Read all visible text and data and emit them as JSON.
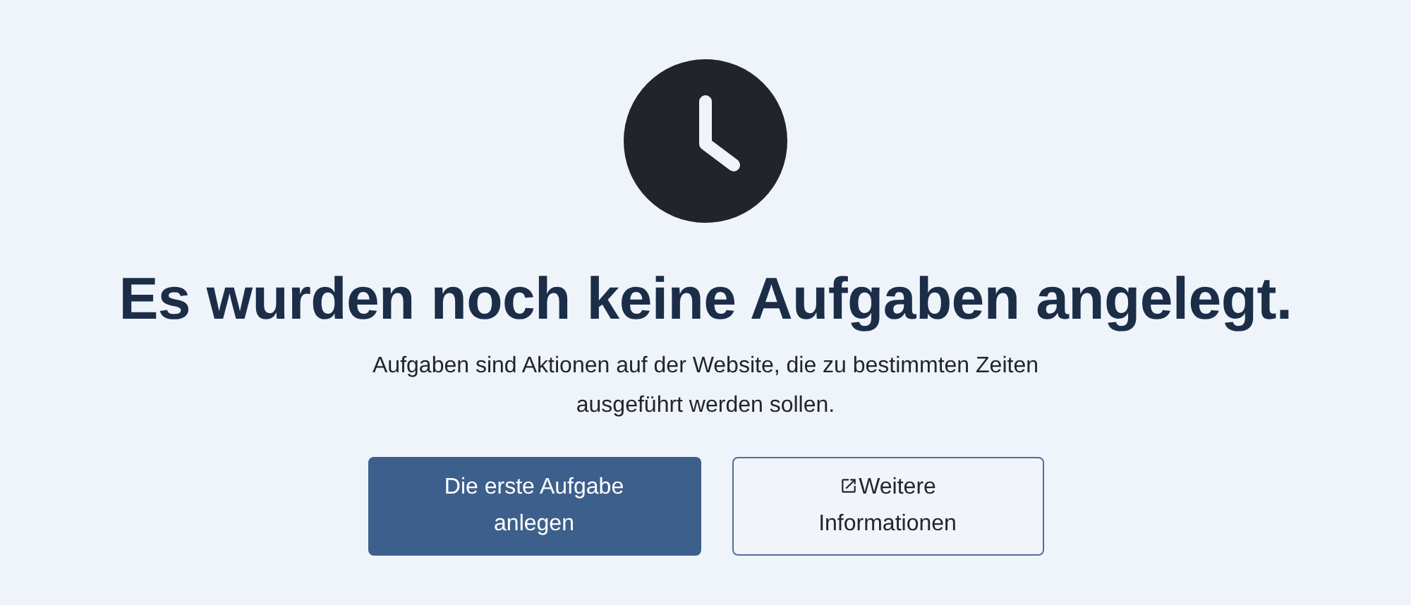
{
  "heading": "Es wurden noch keine Aufgaben angelegt.",
  "description": "Aufgaben sind Aktionen auf der Website, die zu bestimmten Zeiten ausgeführt werden sollen.",
  "buttons": [
    {
      "kind": "primary",
      "label": "Die erste Aufgabe anlegen"
    },
    {
      "kind": "external",
      "label": "Weitere Informationen"
    }
  ]
}
